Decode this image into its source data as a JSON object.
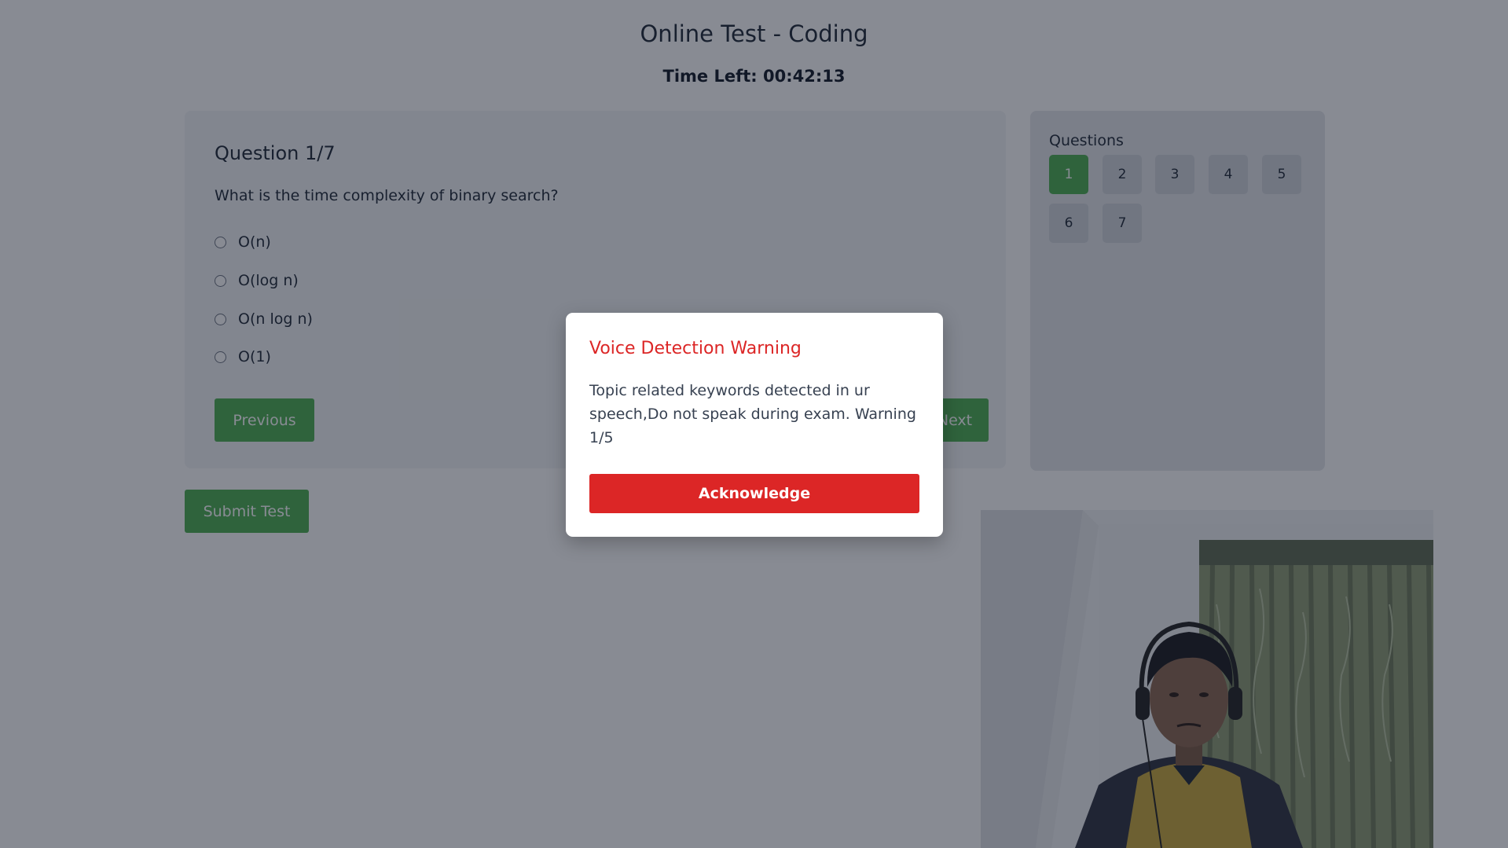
{
  "header": {
    "title": "Online Test - Coding",
    "timer": "Time Left: 00:42:13"
  },
  "question": {
    "heading": "Question 1/7",
    "text": "What is the time complexity of binary search?",
    "options": [
      "O(n)",
      "O(log n)",
      "O(n log n)",
      "O(1)"
    ]
  },
  "navigation": {
    "previous_label": "Previous",
    "next_label": "Next",
    "submit_label": "Submit Test"
  },
  "question_panel": {
    "title": "Questions",
    "numbers": [
      "1",
      "2",
      "3",
      "4",
      "5",
      "6",
      "7"
    ],
    "active": "1"
  },
  "modal": {
    "title": "Voice Detection Warning",
    "message": "Topic related keywords detected in ur speech,Do not speak during exam. Warning 1/5",
    "button_label": "Acknowledge"
  },
  "colors": {
    "accent_green": "#4caf50",
    "warning_red": "#dc2626",
    "overlay": "rgba(17, 24, 39, 0.5)"
  },
  "icons": {
    "webcam": "webcam-feed"
  }
}
